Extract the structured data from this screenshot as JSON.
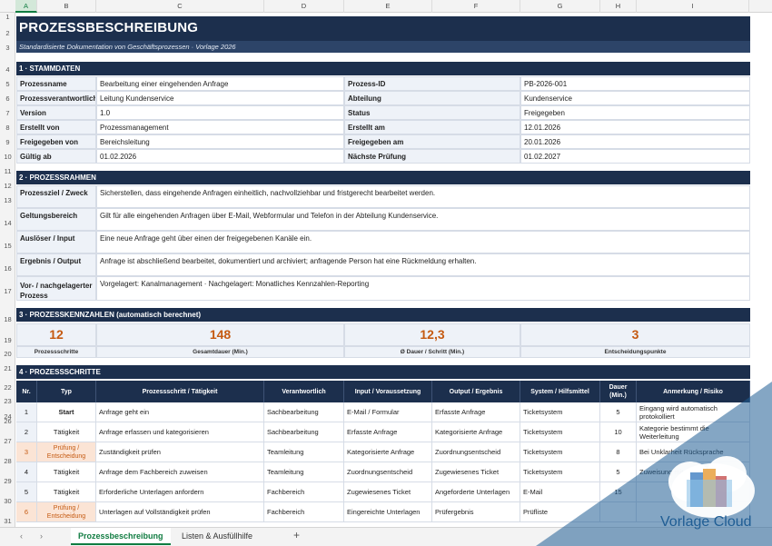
{
  "columns": [
    "A",
    "B",
    "C",
    "D",
    "E",
    "F",
    "G",
    "H",
    "I"
  ],
  "rows": [
    "1",
    "2",
    "3",
    "4",
    "5",
    "6",
    "7",
    "8",
    "9",
    "10",
    "11",
    "12",
    "13",
    "14",
    "15",
    "16",
    "17",
    "18",
    "19",
    "20",
    "21",
    "22",
    "23",
    "24",
    "25",
    "26",
    "27",
    "28",
    "29",
    "30",
    "31"
  ],
  "title": "PROZESSBESCHREIBUNG",
  "subtitle": "Standardisierte Dokumentation von Geschäftsprozessen  ·  Vorlage 2026",
  "section1": {
    "heading": "1  ·  STAMMDATEN",
    "left": [
      {
        "label": "Prozessname",
        "value": "Bearbeitung einer eingehenden Anfrage"
      },
      {
        "label": "Prozessverantwortlicher",
        "value": "Leitung Kundenservice"
      },
      {
        "label": "Version",
        "value": "1.0"
      },
      {
        "label": "Erstellt von",
        "value": "Prozessmanagement"
      },
      {
        "label": "Freigegeben von",
        "value": "Bereichsleitung"
      },
      {
        "label": "Gültig ab",
        "value": "01.02.2026"
      }
    ],
    "right": [
      {
        "label": "Prozess-ID",
        "value": "PB-2026-001"
      },
      {
        "label": "Abteilung",
        "value": "Kundenservice"
      },
      {
        "label": "Status",
        "value": "Freigegeben"
      },
      {
        "label": "Erstellt am",
        "value": "12.01.2026"
      },
      {
        "label": "Freigegeben am",
        "value": "20.01.2026"
      },
      {
        "label": "Nächste Prüfung",
        "value": "01.02.2027"
      }
    ]
  },
  "section2": {
    "heading": "2  ·  PROZESSRAHMEN",
    "rows": [
      {
        "label": "Prozessziel / Zweck",
        "value": "Sicherstellen, dass eingehende Anfragen einheitlich, nachvollziehbar und fristgerecht bearbeitet werden."
      },
      {
        "label": "Geltungsbereich",
        "value": "Gilt für alle eingehenden Anfragen über E-Mail, Webformular und Telefon in der Abteilung Kundenservice."
      },
      {
        "label": "Auslöser / Input",
        "value": "Eine neue Anfrage geht über einen der freigegebenen Kanäle ein."
      },
      {
        "label": "Ergebnis / Output",
        "value": "Anfrage ist abschließend bearbeitet, dokumentiert und archiviert; anfragende Person hat eine Rückmeldung erhalten."
      },
      {
        "label": "Vor- / nachgelagerter Prozess",
        "value": "Vorgelagert: Kanalmanagement   ·   Nachgelagert: Monatliches Kennzahlen-Reporting"
      }
    ]
  },
  "section3": {
    "heading": "3  ·  PROZESSKENNZAHLEN  (automatisch berechnet)",
    "kpis": [
      {
        "value": "12",
        "label": "Prozessschritte"
      },
      {
        "value": "148",
        "label": "Gesamtdauer (Min.)"
      },
      {
        "value": "12,3",
        "label": "Ø Dauer / Schritt (Min.)"
      },
      {
        "value": "3",
        "label": "Entscheidungspunkte"
      }
    ]
  },
  "section4": {
    "heading": "4  ·  PROZESSSCHRITTE",
    "headers": [
      "Nr.",
      "Typ",
      "Prozessschritt / Tätigkeit",
      "Verantwortlich",
      "Input / Voraussetzung",
      "Output / Ergebnis",
      "System / Hilfsmittel",
      "Dauer (Min.)",
      "Anmerkung / Risiko"
    ],
    "steps": [
      {
        "nr": "1",
        "typ": "Start",
        "task": "Anfrage geht ein",
        "resp": "Sachbearbeitung",
        "input": "E-Mail / Formular",
        "output": "Erfasste Anfrage",
        "system": "Ticketsystem",
        "dauer": "5",
        "note": "Eingang wird automatisch protokolliert"
      },
      {
        "nr": "2",
        "typ": "Tätigkeit",
        "task": "Anfrage erfassen und kategorisieren",
        "resp": "Sachbearbeitung",
        "input": "Erfasste Anfrage",
        "output": "Kategorisierte Anfrage",
        "system": "Ticketsystem",
        "dauer": "10",
        "note": "Kategorie bestimmt die Weiterleitung"
      },
      {
        "nr": "3",
        "typ": "Prüfung / Entscheidung",
        "task": "Zuständigkeit prüfen",
        "resp": "Teamleitung",
        "input": "Kategorisierte Anfrage",
        "output": "Zuordnungsentscheid",
        "system": "Ticketsystem",
        "dauer": "8",
        "note": "Bei Unklarheit Rücksprache"
      },
      {
        "nr": "4",
        "typ": "Tätigkeit",
        "task": "Anfrage dem Fachbereich zuweisen",
        "resp": "Teamleitung",
        "input": "Zuordnungsentscheid",
        "output": "Zugewiesenes Ticket",
        "system": "Ticketsystem",
        "dauer": "5",
        "note": "Zuweisung mit Frist"
      },
      {
        "nr": "5",
        "typ": "Tätigkeit",
        "task": "Erforderliche Unterlagen anfordern",
        "resp": "Fachbereich",
        "input": "Zugewiesenes Ticket",
        "output": "Angeforderte Unterlagen",
        "system": "E-Mail",
        "dauer": "15",
        "note": ""
      },
      {
        "nr": "6",
        "typ": "Prüfung / Entscheidung",
        "task": "Unterlagen auf Vollständigkeit prüfen",
        "resp": "Fachbereich",
        "input": "Eingereichte Unterlagen",
        "output": "Prüfergebnis",
        "system": "Prüfliste",
        "dauer": "",
        "note": ""
      }
    ]
  },
  "tabs": {
    "sheet1": "Prozessbeschreibung",
    "sheet2": "Listen & Ausfüllhilfe",
    "add": "+",
    "prev": "‹",
    "next": "›"
  },
  "watermark": {
    "text": "Vorlage Cloud"
  },
  "colors": {
    "navy": "#1c2f4d",
    "accent": "#c55a11",
    "label_bg": "#eef2f8",
    "excel_green": "#107c41"
  }
}
